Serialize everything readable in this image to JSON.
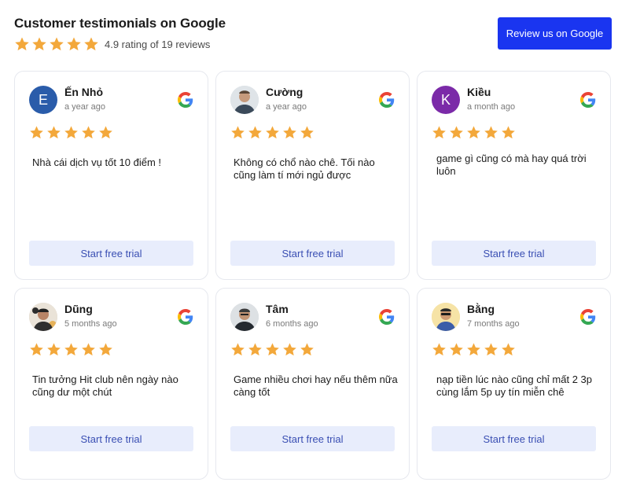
{
  "header": {
    "title": "Customer testimonials on Google",
    "rating_text": "4.9 rating of 19 reviews",
    "review_button": "Review us on Google"
  },
  "colors": {
    "accent": "#1a35f0",
    "star": "#f3a83b",
    "cta_bg": "#e8edfc",
    "cta_text": "#3a4fb3"
  },
  "reviews": [
    {
      "name": "Ến Nhỏ",
      "time": "a year ago",
      "stars": 5,
      "text": "Nhà cái dịch vụ tốt 10 điểm !",
      "cta": "Start free trial",
      "avatar_initial": "E",
      "avatar_color": "#2a5caa",
      "source_icon": "google-icon"
    },
    {
      "name": "Cường",
      "time": "a year ago",
      "stars": 5,
      "text": "Không có chổ nào chê. Tối nào cũng làm tí mới ngủ được",
      "cta": "Start free trial",
      "avatar_initial": "",
      "avatar_color": "#c9d3da",
      "source_icon": "google-icon"
    },
    {
      "name": "Kiều",
      "time": "a month ago",
      "stars": 5,
      "text": "game gì cũng có mà hay quá trời luôn",
      "cta": "Start free trial",
      "avatar_initial": "K",
      "avatar_color": "#7b2aa8",
      "source_icon": "google-icon"
    },
    {
      "name": "Dũng",
      "time": "5 months ago",
      "stars": 5,
      "text": "Tin tưởng Hit club nên ngày nào cũng dư một chút",
      "cta": "Start free trial",
      "avatar_initial": "",
      "avatar_color": "#d4c9bb",
      "source_icon": "google-icon"
    },
    {
      "name": "Tâm",
      "time": "6 months ago",
      "stars": 5,
      "text": "Game nhiều chơi hay nếu thêm nữa càng tốt",
      "cta": "Start free trial",
      "avatar_initial": "",
      "avatar_color": "#c8cdd2",
      "source_icon": "google-icon"
    },
    {
      "name": "Bằng",
      "time": "7 months ago",
      "stars": 5,
      "text": "nạp tiền lúc nào cũng chỉ mất 2 3p cùng lắm 5p uy tín miễn chê",
      "cta": "Start free trial",
      "avatar_initial": "",
      "avatar_color": "#f2d98a",
      "source_icon": "google-icon"
    }
  ]
}
